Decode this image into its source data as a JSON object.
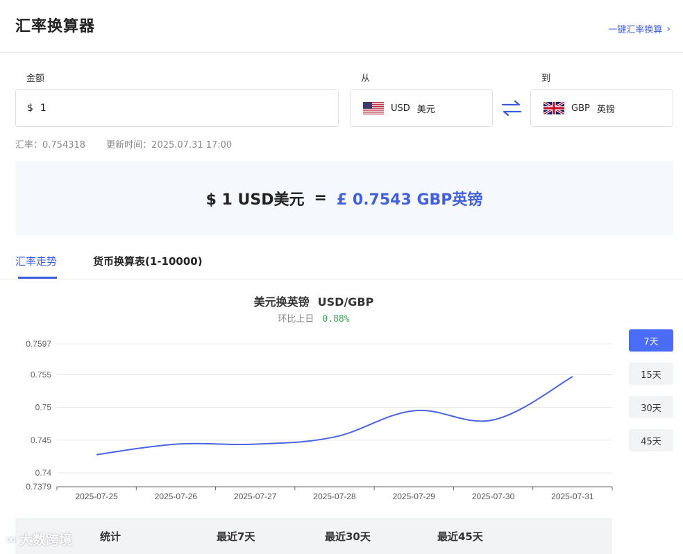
{
  "header": {
    "title": "汇率换算器",
    "quick_link": "一键汇率换算"
  },
  "form": {
    "amount_label": "金额",
    "from_label": "从",
    "to_label": "到",
    "amount_symbol": "$",
    "amount_value": "1",
    "from": {
      "code": "USD",
      "name": "美元",
      "flag": "us-flag-icon"
    },
    "to": {
      "code": "GBP",
      "name": "英镑",
      "flag": "uk-flag-icon"
    }
  },
  "rate_info": {
    "rate": "汇率：0.754318",
    "updated": "更新时间：2025.07.31 17:00"
  },
  "result": {
    "left": "$ 1 USD美元",
    "equals": "=",
    "right": "£ 0.7543 GBP英镑"
  },
  "tabs": [
    {
      "label": "汇率走势",
      "active": true
    },
    {
      "label": "货币换算表(1-10000)",
      "active": false
    }
  ],
  "chart_header": {
    "title": "美元换英镑",
    "pair": "USD/GBP",
    "change_label": "环比上日",
    "change_value": "0.88%"
  },
  "periods": [
    "7天",
    "15天",
    "30天",
    "45天"
  ],
  "active_period": "7天",
  "stats": {
    "col1": "统计",
    "col2": "最近7天",
    "col3": "最近30天",
    "col4": "最近45天"
  },
  "watermark": "大数跨境",
  "colors": {
    "accent": "#3b5bdb",
    "line": "#4a63e0",
    "positive": "#3aa757"
  },
  "chart_data": {
    "type": "line",
    "categories": [
      "2025-07-25",
      "2025-07-26",
      "2025-07-27",
      "2025-07-28",
      "2025-07-29",
      "2025-07-30",
      "2025-07-31"
    ],
    "series": [
      {
        "values": [
          0.7428,
          0.7444,
          0.7444,
          0.7455,
          0.7495,
          0.7481,
          0.7547
        ]
      }
    ],
    "y_ticks": [
      "0.7597",
      "0.755",
      "0.75",
      "0.745",
      "0.74",
      "0.7379"
    ],
    "ylim": [
      0.7379,
      0.7597
    ],
    "grid": true,
    "smooth": true
  }
}
